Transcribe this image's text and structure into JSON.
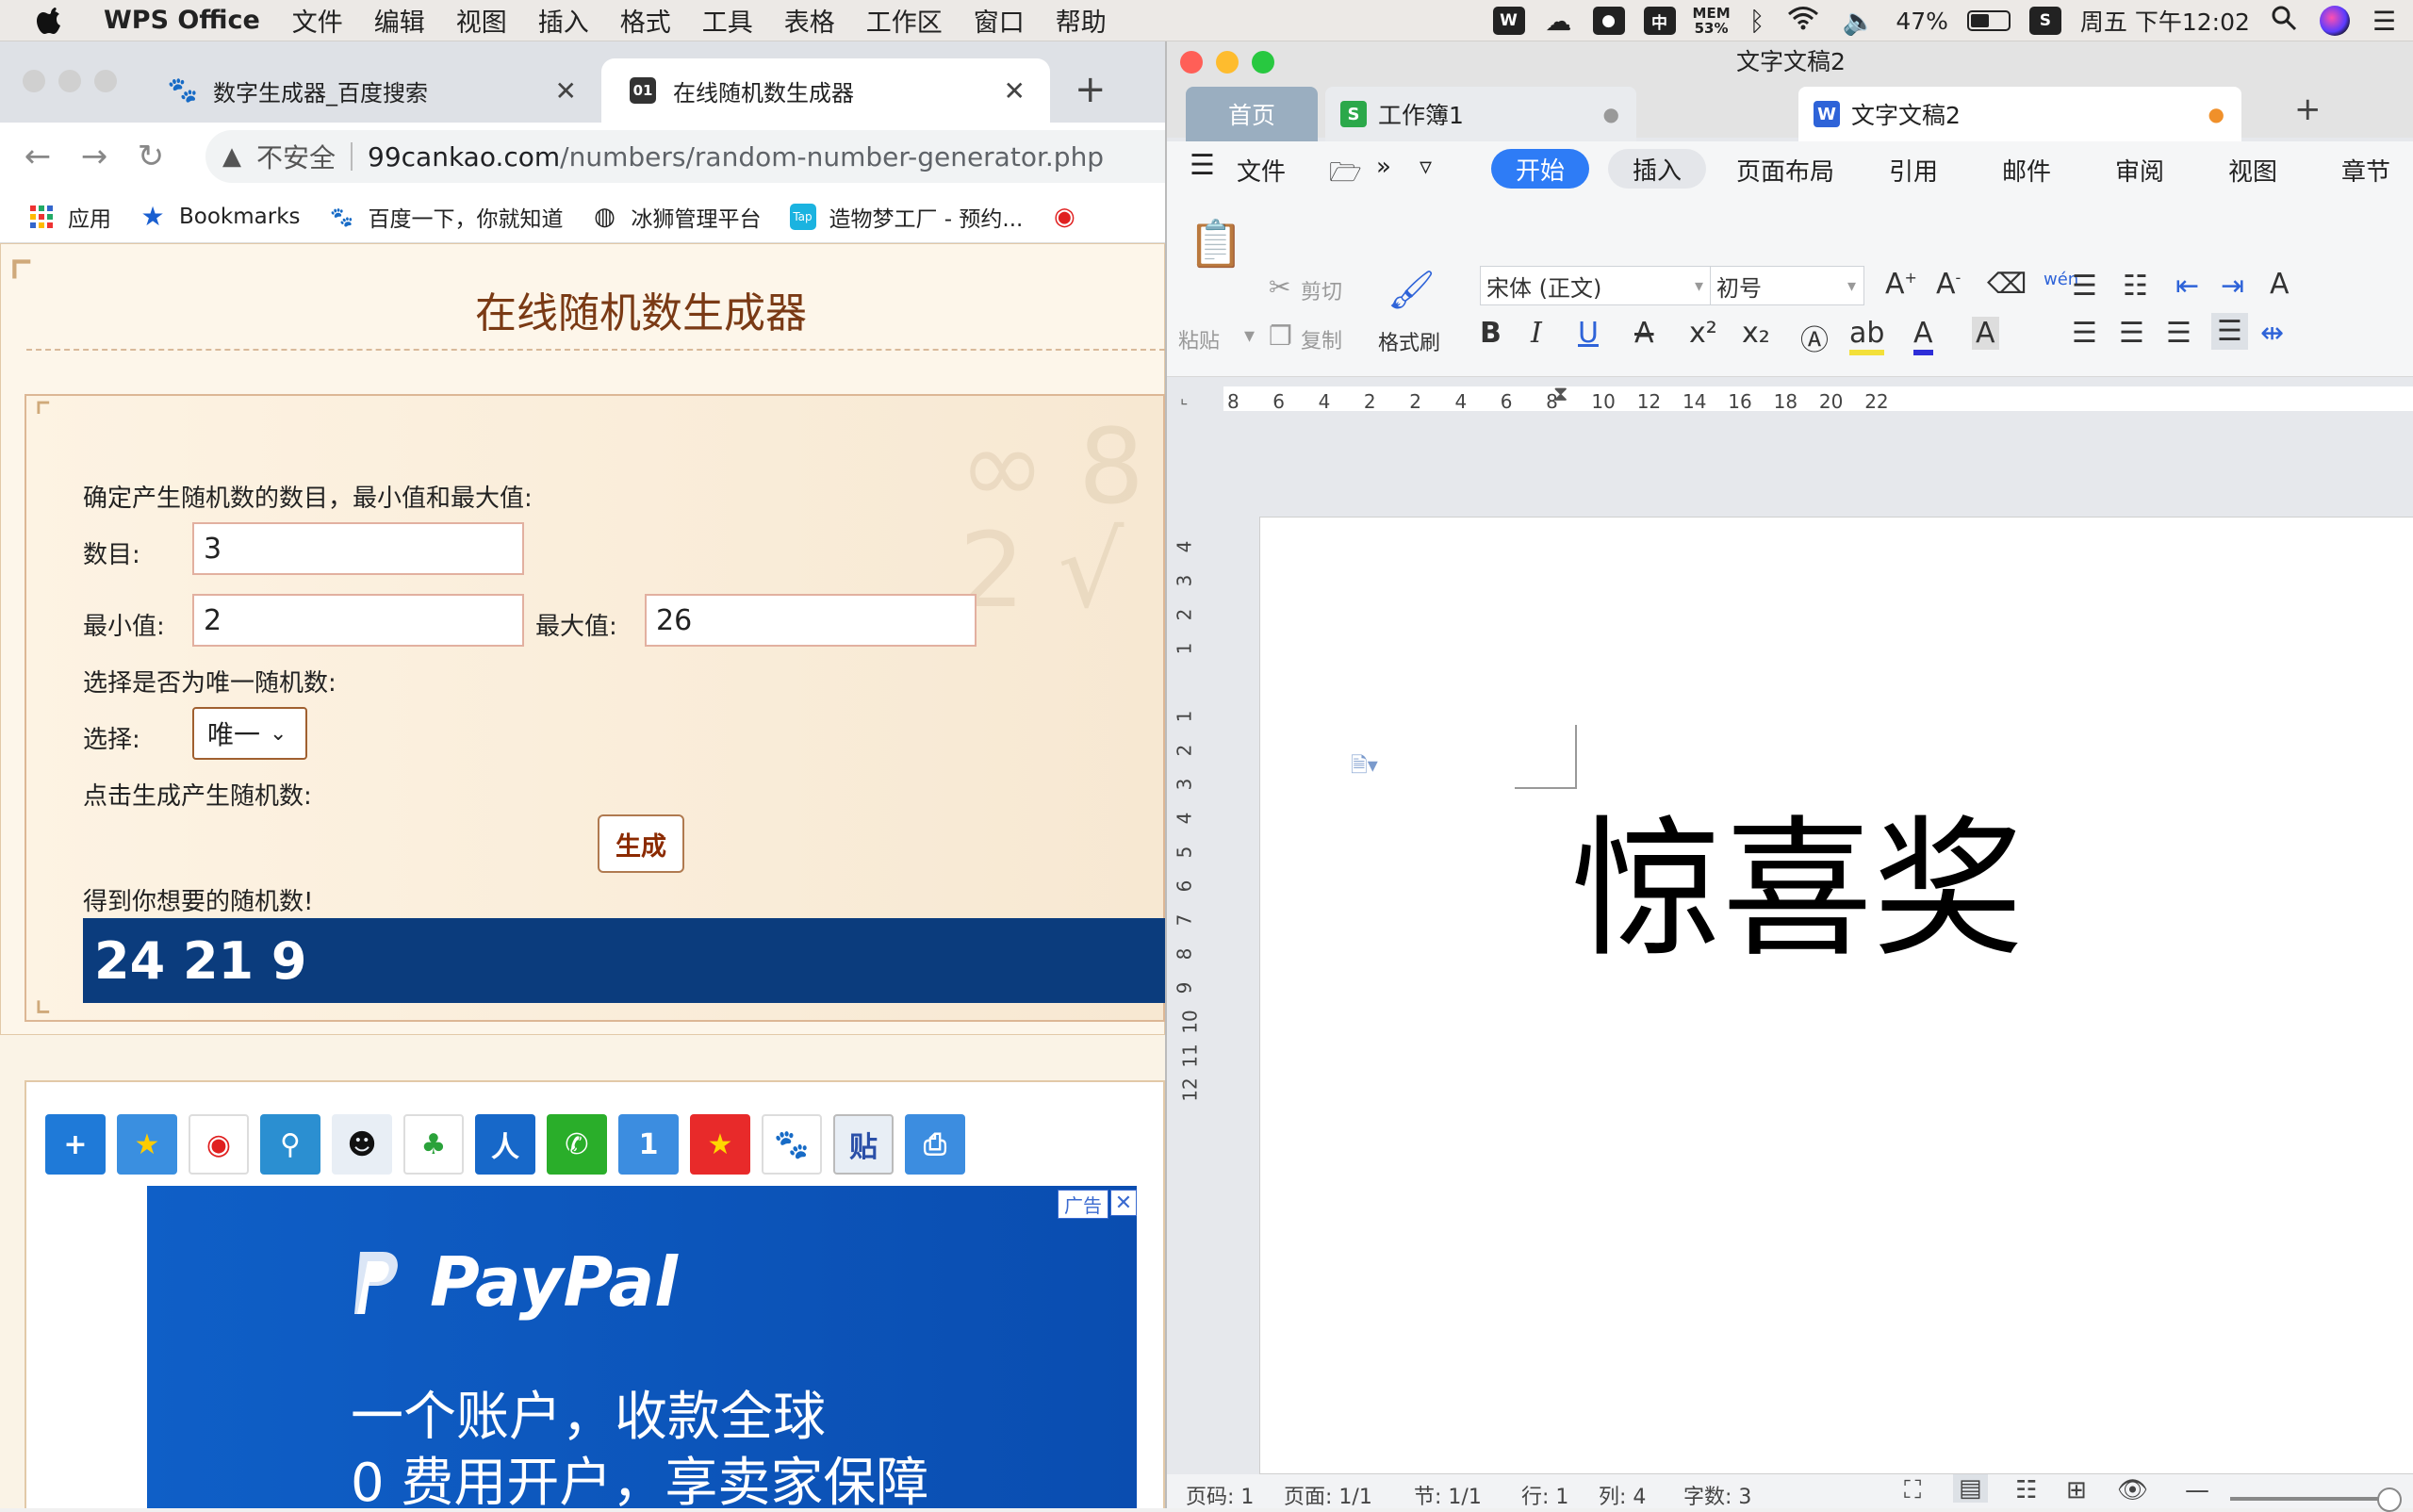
{
  "menubar": {
    "app_name": "WPS Office",
    "items": [
      "文件",
      "编辑",
      "视图",
      "插入",
      "格式",
      "工具",
      "表格",
      "工作区",
      "窗口",
      "帮助"
    ],
    "status": {
      "mem_label": "MEM",
      "mem_value": "53%",
      "ime": "中",
      "battery": "47%",
      "battery_level": 0.47,
      "datetime": "周五 下午12:02"
    }
  },
  "browser": {
    "tabs": [
      {
        "title": "数字生成器_百度搜索",
        "icon": "baidu-paw-icon"
      },
      {
        "title": "在线随机数生成器",
        "icon": "01-favicon-icon",
        "favicon_text": "01"
      }
    ],
    "address": {
      "insecure": "不安全",
      "domain": "99cankao.com",
      "path": "/numbers/random-number-generator.php"
    },
    "bookmarks": [
      {
        "label": "应用",
        "icon": "apps-grid-icon"
      },
      {
        "label": "Bookmarks",
        "icon": "star-icon"
      },
      {
        "label": "百度一下，你就知道",
        "icon": "baidu-paw-icon"
      },
      {
        "label": "冰狮管理平台",
        "icon": "globe-icon"
      },
      {
        "label": "造物梦工厂 - 预约...",
        "icon": "tap-icon",
        "icon_text": "Tap"
      }
    ]
  },
  "page": {
    "title": "在线随机数生成器",
    "instruction": "确定产生随机数的数目，最小值和最大值:",
    "count_label": "数目:",
    "count_value": "3",
    "min_label": "最小值:",
    "min_value": "2",
    "max_label": "最大值:",
    "max_value": "26",
    "unique_prompt": "选择是否为唯一随机数:",
    "select_label": "选择:",
    "select_value": "唯一",
    "click_prompt": "点击生成产生随机数:",
    "generate_button": "生成",
    "result_label": "得到你想要的随机数!",
    "result_value": "24 21 9"
  },
  "share_icons": [
    "plus-share-icon",
    "qzone-star-icon",
    "weibo-icon",
    "search-share-icon",
    "qq-penguin-icon",
    "clover-icon",
    "renren-icon",
    "wechat-icon",
    "number-one-icon",
    "smiley-star-icon",
    "baidu-paw-icon",
    "tieba-icon",
    "print-icon"
  ],
  "share_glyphs": {
    "plus": "+",
    "tieba": "贴",
    "renren": "人",
    "one": "1"
  },
  "ad": {
    "tag": "广告",
    "close": "✕",
    "brand": "PayPal",
    "line1": "一个账户，收款全球",
    "line2": "0 费用开户，享卖家保障"
  },
  "wps": {
    "window_title": "文字文稿2",
    "tabs": [
      {
        "label": "首页"
      },
      {
        "label": "工作簿1",
        "icon": "spreadsheet-icon",
        "icon_text": "S"
      },
      {
        "label": "文字文稿2",
        "icon": "writer-icon",
        "icon_text": "W"
      }
    ],
    "menu": {
      "file": "文件",
      "start": "开始",
      "insert": "插入",
      "layout": "页面布局",
      "refs": "引用",
      "mail": "邮件",
      "review": "审阅",
      "view": "视图",
      "chapter": "章节"
    },
    "ribbon": {
      "paste": "粘贴",
      "cut": "剪切",
      "copy": "复制",
      "format_painter": "格式刷",
      "font": "宋体 (正文)",
      "size": "初号",
      "pinyin": "wén",
      "bold": "B",
      "italic": "I",
      "underline": "U"
    },
    "ruler_h": [
      "8",
      "6",
      "4",
      "2",
      "2",
      "4",
      "6",
      "8",
      "10",
      "12",
      "14",
      "16",
      "18",
      "20",
      "22"
    ],
    "ruler_v": [
      "4",
      "3",
      "2",
      "1",
      "1",
      "2",
      "3",
      "4",
      "5",
      "6",
      "7",
      "8",
      "9",
      "10",
      "11",
      "12"
    ],
    "doc_text": "惊喜奖",
    "status": {
      "page": "页码: 1",
      "pages": "页面: 1/1",
      "section": "节: 1/1",
      "row": "行: 1",
      "col": "列: 4",
      "words": "字数: 3"
    }
  }
}
